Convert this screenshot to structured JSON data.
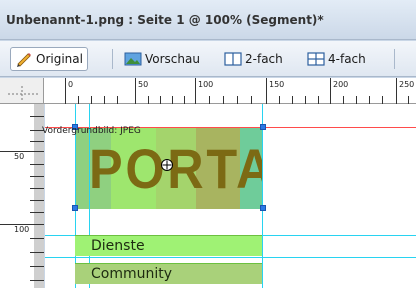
{
  "window": {
    "title": "Unbenannt-1.png : Seite 1 @ 100% (Segment)*"
  },
  "view_tabs": [
    {
      "label": "Original",
      "icon": "pencil-icon",
      "active": true
    },
    {
      "label": "Vorschau",
      "icon": "preview-image-icon",
      "active": false
    },
    {
      "label": "2-fach",
      "icon": "two-pane-icon",
      "active": false
    },
    {
      "label": "4-fach",
      "icon": "four-pane-icon",
      "active": false
    }
  ],
  "ruler": {
    "top_numbers": [
      "0",
      "50",
      "100",
      "150",
      "200",
      "250"
    ],
    "left_numbers": [
      "50",
      "100"
    ]
  },
  "canvas": {
    "image_label": "Vordergrundbild: JPEG",
    "logo_text": "PORTAL",
    "bars": [
      {
        "label": "Dienste"
      },
      {
        "label": "Community"
      }
    ]
  },
  "colors": {
    "guide_red": "#ff4b4b",
    "guide_cyan": "#28d3f1",
    "selection_handle": "#2a79e6",
    "bar_green": "#9ff274",
    "bar_olive": "#a9d17a"
  }
}
